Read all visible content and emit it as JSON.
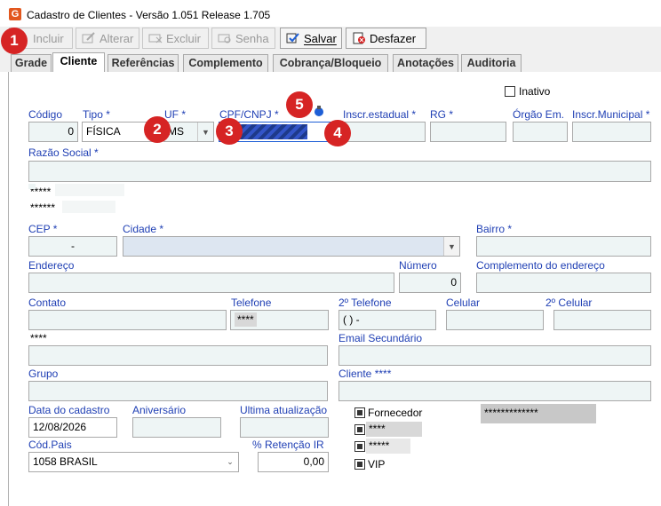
{
  "window": {
    "title": "Cadastro de Clientes - Versão 1.051 Release 1.705",
    "icon": "app-logo-icon"
  },
  "toolbar": {
    "incluir": "Incluir",
    "alterar": "Alterar",
    "excluir": "Excluir",
    "senha": "Senha",
    "salvar": "Salvar",
    "desfazer": "Desfazer"
  },
  "tabs": [
    "Grade",
    "Cliente",
    "Referências",
    "Complemento",
    "Cobrança/Bloqueio",
    "Anotações",
    "Auditoria"
  ],
  "form": {
    "inativo": "Inativo",
    "codigo_label": "Código",
    "codigo": "0",
    "tipo_label": "Tipo *",
    "tipo": "FÍSICA",
    "uf_label": "UF *",
    "uf": "MS",
    "cpf_label": "CPF/CNPJ *",
    "inscr_estadual_label": "Inscr.estadual *",
    "rg_label": "RG *",
    "orgao_label": "Órgão Em.",
    "inscr_municipal_label": "Inscr.Municipal *",
    "razao_label": "Razão Social *",
    "masked1": "*****",
    "masked2": "******",
    "cep_label": "CEP *",
    "cep": "-",
    "cidade_label": "Cidade *",
    "bairro_label": "Bairro *",
    "endereco_label": "Endereço",
    "numero_label": "Número",
    "numero": "0",
    "complemento_label": "Complemento do endereço",
    "contato_label": "Contato",
    "telefone_label": "Telefone",
    "telefone": "****",
    "tel2_label": "2º Telefone",
    "tel2": "( )    -",
    "celular_label": "Celular",
    "celular2_label": "2º Celular",
    "masked3": "****",
    "email_sec_label": "Email Secundário",
    "grupo_label": "Grupo",
    "cliente_label": "Cliente ****",
    "data_cadastro_label": "Data do cadastro",
    "data_cadastro": "12/08/2026",
    "aniversario_label": "Aniversário",
    "ultima_label": "Ultima atualização",
    "fornecedor_label": "Fornecedor",
    "fornecedor_field": "*************",
    "check2_label": "****",
    "check3_label": "*****",
    "vip_label": "VIP",
    "cod_pais_label": "Cód.Pais",
    "cod_pais": "1058 BRASIL",
    "retencao_label": "% Retenção IR",
    "retencao": "0,00"
  },
  "badges": [
    "1",
    "2",
    "3",
    "4",
    "5"
  ],
  "colors": {
    "label": "#1f3fb4",
    "field_bg": "#eef5f5",
    "badge": "#d62424",
    "accent_icon": "#1e5fd6"
  }
}
